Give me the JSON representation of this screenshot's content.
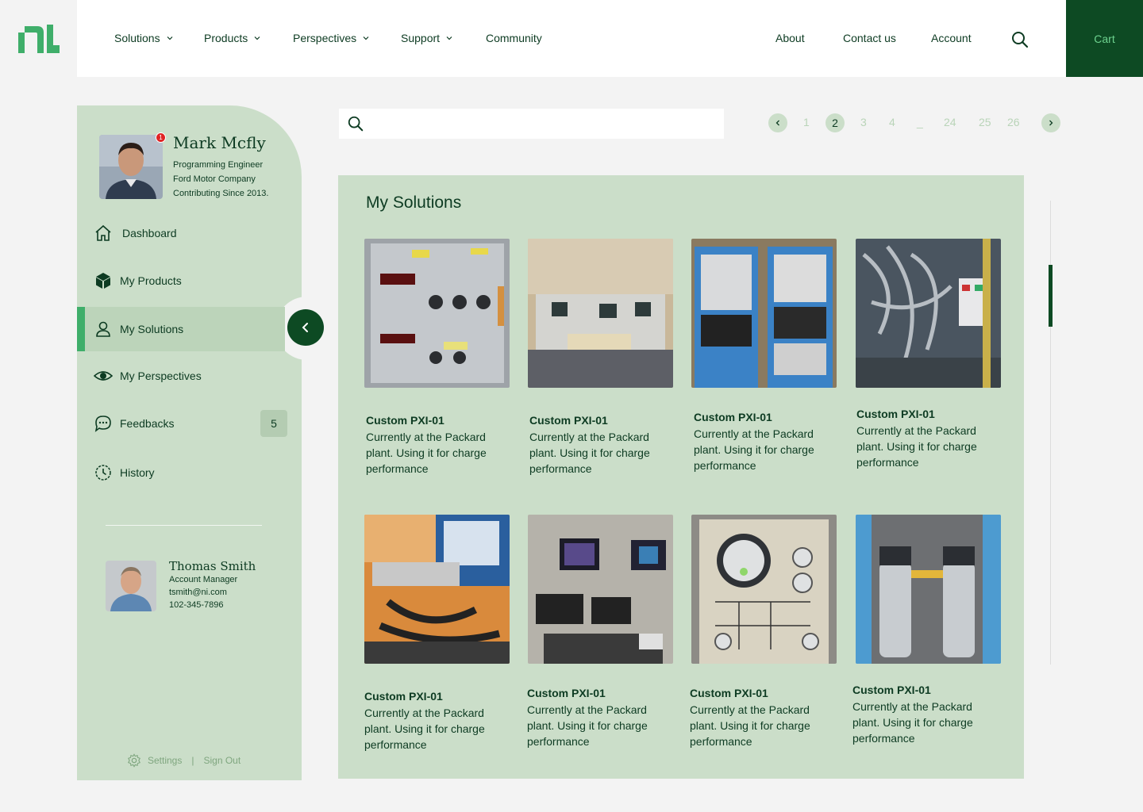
{
  "brand": {
    "logo": "ni-logo",
    "accent": "#0d4a23",
    "light_green": "#cbdec9",
    "bright_green": "#3fae6a"
  },
  "nav": {
    "left": [
      {
        "label": "Solutions",
        "dropdown": true
      },
      {
        "label": "Products",
        "dropdown": true
      },
      {
        "label": "Perspectives",
        "dropdown": true
      },
      {
        "label": "Support",
        "dropdown": true
      },
      {
        "label": "Community",
        "dropdown": false
      }
    ],
    "right": [
      {
        "label": "About"
      },
      {
        "label": "Contact us"
      },
      {
        "label": "Account"
      }
    ],
    "search_icon": "search-icon",
    "cart_label": "Cart"
  },
  "profile": {
    "name": "Mark Mcfly",
    "title": "Programming Engineer",
    "company": "Ford Motor Company",
    "since": "Contributing Since 2013.",
    "notifications": "1"
  },
  "sidebar": {
    "items": [
      {
        "label": "Dashboard",
        "icon": "home-icon"
      },
      {
        "label": "My Products",
        "icon": "box-icon"
      },
      {
        "label": "My Solutions",
        "icon": "user-icon",
        "active": true
      },
      {
        "label": "My Perspectives",
        "icon": "eye-icon"
      },
      {
        "label": "Feedbacks",
        "icon": "chat-icon",
        "badge": "5"
      },
      {
        "label": "History",
        "icon": "clock-icon"
      }
    ],
    "settings_label": "Settings",
    "separator": "|",
    "signout_label": "Sign Out"
  },
  "manager": {
    "name": "Thomas Smith",
    "role": "Account Manager",
    "email": "tsmith@ni.com",
    "phone": "102-345-7896"
  },
  "search": {
    "placeholder": ""
  },
  "pagination": {
    "pages": [
      "1",
      "2",
      "3",
      "4",
      "_",
      "24",
      "25",
      "26"
    ],
    "current": "2"
  },
  "main": {
    "title": "My Solutions",
    "cards": [
      {
        "title": "Custom PXI-01",
        "desc": "Currently at the Packard plant. Using it for charge performance"
      },
      {
        "title": "Custom PXI-01",
        "desc": "Currently at the Packard plant. Using it for charge performance"
      },
      {
        "title": "Custom PXI-01",
        "desc": "Currently at the Packard plant. Using it for charge performance"
      },
      {
        "title": "Custom PXI-01",
        "desc": "Currently at the Packard plant. Using it for charge performance"
      },
      {
        "title": "Custom PXI-01",
        "desc": "Currently at the Packard plant. Using it for charge performance"
      },
      {
        "title": "Custom PXI-01",
        "desc": "Currently at the Packard plant. Using it for charge performance"
      },
      {
        "title": "Custom PXI-01",
        "desc": "Currently at the Packard plant. Using it for charge performance"
      },
      {
        "title": "Custom PXI-01",
        "desc": "Currently at the Packard plant. Using it for charge performance"
      }
    ]
  }
}
